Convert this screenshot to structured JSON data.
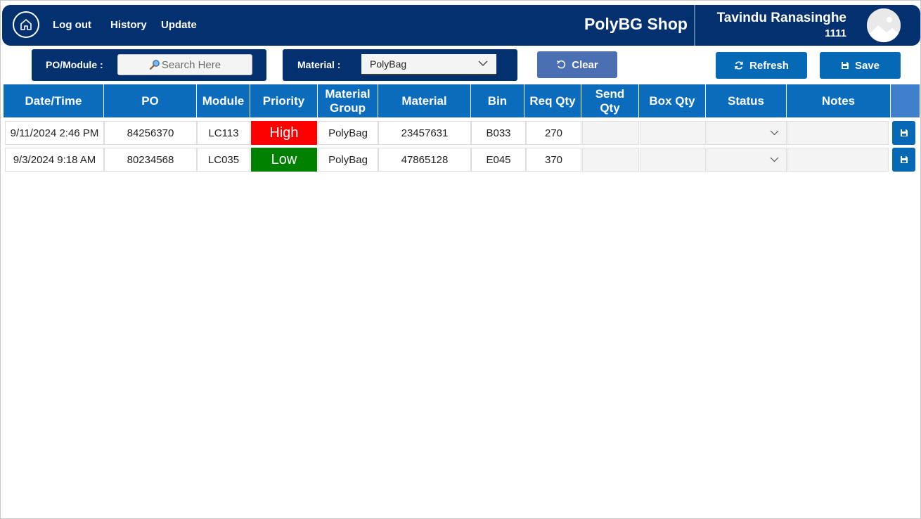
{
  "header": {
    "nav": {
      "logout": "Log out",
      "history": "History",
      "update": "Update"
    },
    "app_title": "PolyBG Shop",
    "user": {
      "name": "Tavindu Ranasinghe",
      "id": "1111"
    }
  },
  "filters": {
    "po_module_label": "PO/Module :",
    "search_placeholder": "Search Here",
    "material_label": "Material :",
    "material_selected": "PolyBag"
  },
  "buttons": {
    "clear": "Clear",
    "refresh": "Refresh",
    "save": "Save"
  },
  "table": {
    "headers": {
      "datetime": "Date/Time",
      "po": "PO",
      "module": "Module",
      "priority": "Priority",
      "material_group": "Material Group",
      "material": "Material",
      "bin": "Bin",
      "req_qty": "Req Qty",
      "send_qty": "Send Qty",
      "box_qty": "Box Qty",
      "status": "Status",
      "notes": "Notes"
    },
    "rows": [
      {
        "datetime": "9/11/2024 2:46 PM",
        "po": "84256370",
        "module": "LC113",
        "priority": "High",
        "material_group": "PolyBag",
        "material": "23457631",
        "bin": "B033",
        "req_qty": "270"
      },
      {
        "datetime": "9/3/2024 9:18 AM",
        "po": "80234568",
        "module": "LC035",
        "priority": "Low",
        "material_group": "PolyBag",
        "material": "47865128",
        "bin": "E045",
        "req_qty": "370"
      }
    ]
  },
  "colors": {
    "header_bg": "#03306e",
    "table_header_bg": "#0b6cbd",
    "accent_button": "#0569b6",
    "clear_button": "#4a6fb3",
    "priority_high": "#ff0000",
    "priority_low": "#008000"
  },
  "icons": {
    "home": "home-icon",
    "search": "magnifier-icon",
    "chevron": "chevron-down-icon",
    "clear": "undo-icon",
    "refresh": "refresh-icon",
    "save": "floppy-disk-icon",
    "avatar": "image-placeholder-icon"
  }
}
